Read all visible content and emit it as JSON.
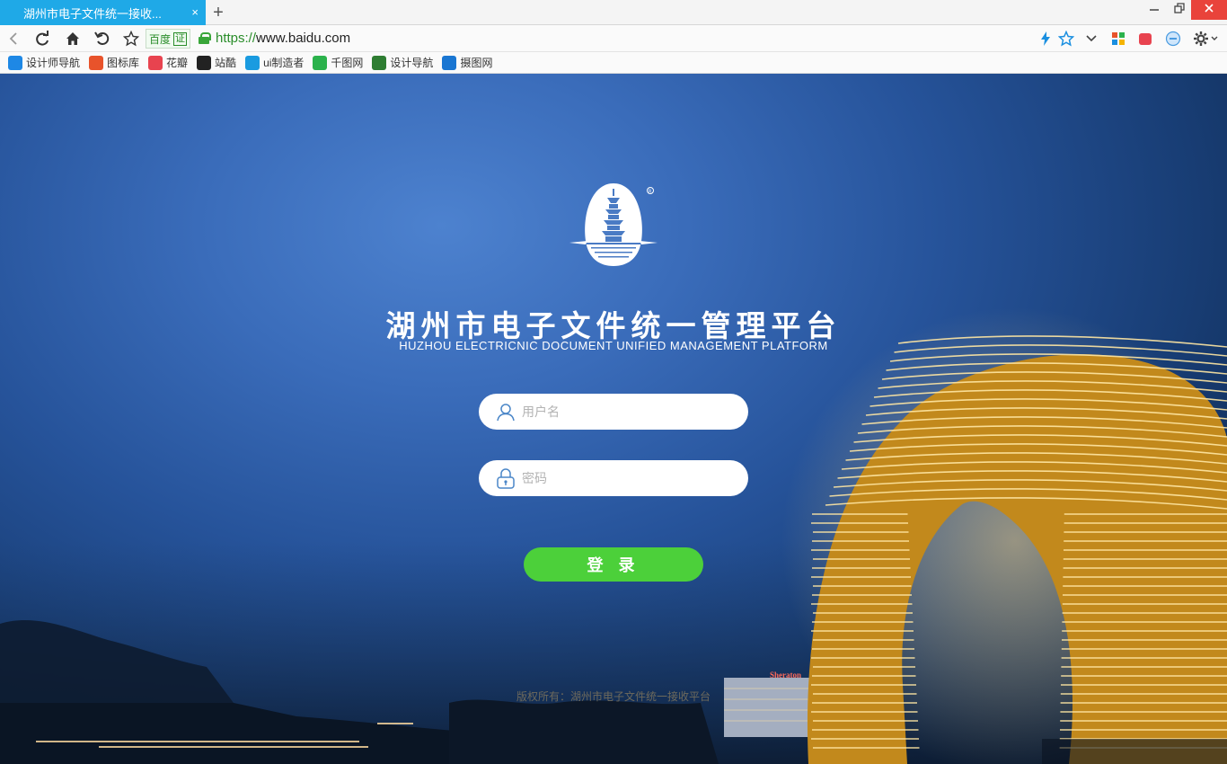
{
  "browser": {
    "tab_title": "湖州市电子文件统一接收...",
    "tab_close": "×",
    "new_tab": "+",
    "url_scheme": "https://",
    "url_host": "www.baidu.com",
    "id_badge": "百度",
    "id_badge_verified": "证"
  },
  "bookmarks": [
    {
      "label": "设计师导航",
      "icon": "ug-icon",
      "color": "#1e88e5"
    },
    {
      "label": "图标库",
      "icon": "iconlib-icon",
      "color": "#e8532b"
    },
    {
      "label": "花瓣",
      "icon": "huaban-icon",
      "color": "#e8434f"
    },
    {
      "label": "站酷",
      "icon": "zcool-icon",
      "color": "#222222"
    },
    {
      "label": "ui制造者",
      "icon": "uimaker-icon",
      "color": "#1a9be0"
    },
    {
      "label": "千图网",
      "icon": "qiantu-icon",
      "color": "#2bb24c"
    },
    {
      "label": "设计导航",
      "icon": "shield-icon",
      "color": "#2e7d32"
    },
    {
      "label": "摄图网",
      "icon": "shetu-icon",
      "color": "#1976d2"
    }
  ],
  "page": {
    "title_cn": "湖州市电子文件统一管理平台",
    "title_en": "HUZHOU ELECTRICNIC DOCUMENT UNIFIED MANAGEMENT PLATFORM",
    "username_placeholder": "用户名",
    "password_placeholder": "密码",
    "login_label": "登 录",
    "copyright": "版权所有：湖州市电子文件统一接收平台",
    "building_sign": "Sheraton"
  },
  "colors": {
    "tab_active": "#1fa9e7",
    "login_button": "#4cd03a",
    "close_button": "#e9433b"
  }
}
